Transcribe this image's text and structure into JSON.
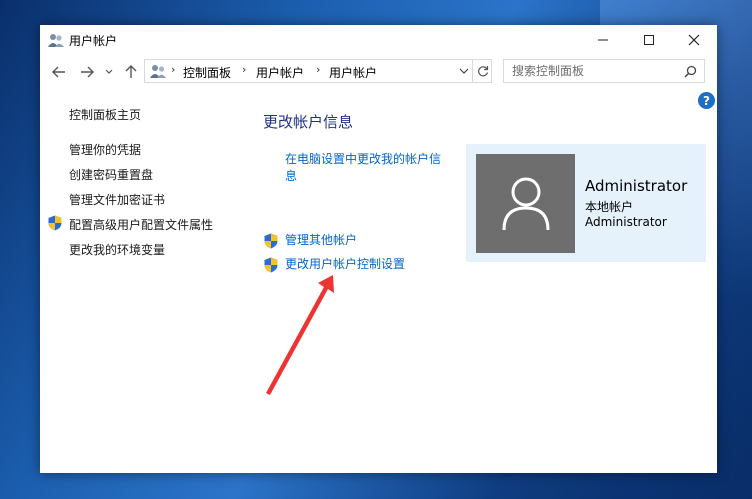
{
  "window": {
    "title": "用户帐户",
    "minimize": "minimize",
    "maximize": "maximize",
    "close": "close"
  },
  "nav": {
    "breadcrumbs": [
      "控制面板",
      "用户帐户",
      "用户帐户"
    ],
    "search_placeholder": "搜索控制面板"
  },
  "sidebar": {
    "home": "控制面板主页",
    "items": [
      {
        "label": "管理你的凭据",
        "shield": false
      },
      {
        "label": "创建密码重置盘",
        "shield": false
      },
      {
        "label": "管理文件加密证书",
        "shield": false
      },
      {
        "label": "配置高级用户配置文件属性",
        "shield": true
      },
      {
        "label": "更改我的环境变量",
        "shield": false
      }
    ]
  },
  "main": {
    "title": "更改帐户信息",
    "pc_settings_link": "在电脑设置中更改我的帐户信息",
    "actions": [
      {
        "label": "管理其他帐户",
        "shield": true
      },
      {
        "label": "更改用户帐户控制设置",
        "shield": true
      }
    ]
  },
  "user": {
    "name": "Administrator",
    "type": "本地帐户",
    "role": "Administrator"
  },
  "colors": {
    "link": "#0066cc",
    "title": "#1e3287",
    "card_bg": "#e5f1fb",
    "annotation_arrow": "#ee3333"
  }
}
